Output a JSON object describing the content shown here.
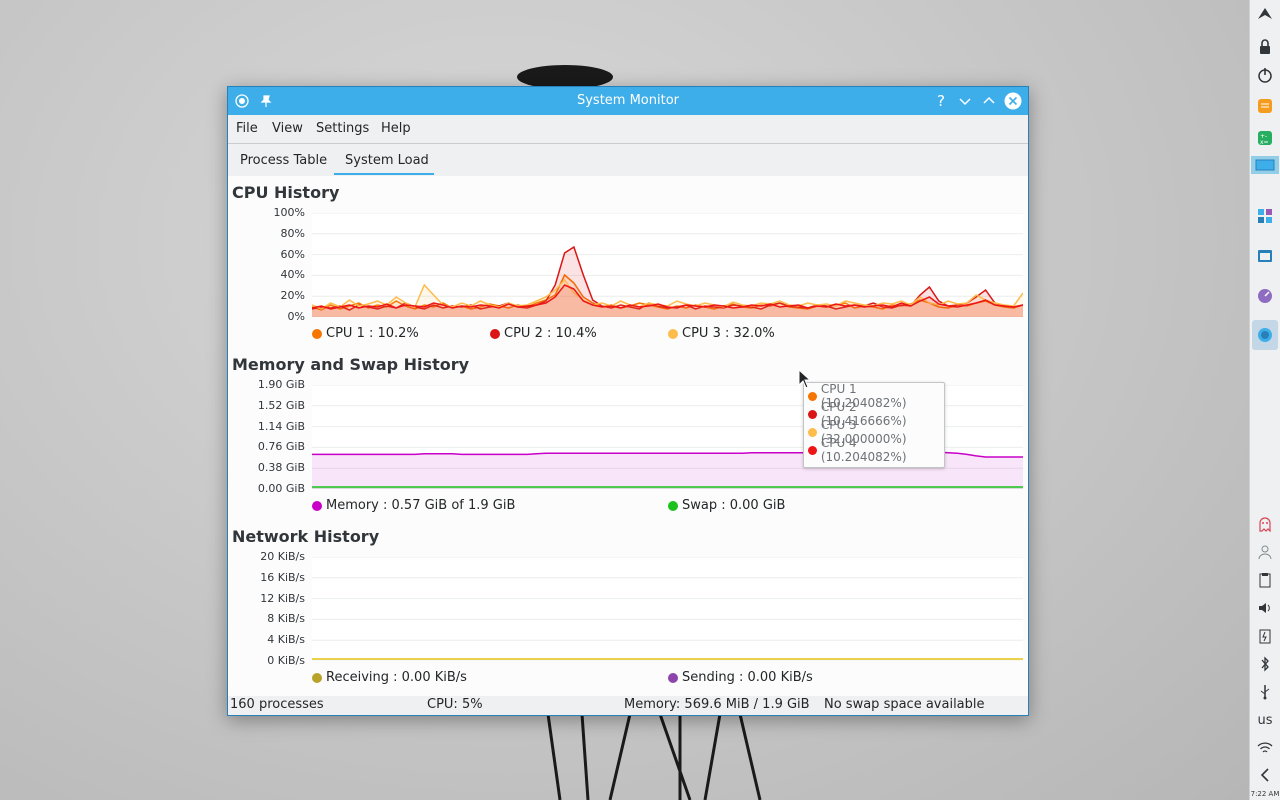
{
  "window": {
    "title": "System Monitor",
    "help_glyph": "?",
    "minimize_glyph": "⌄",
    "maximize_glyph": "⌃",
    "close_glyph": "✕",
    "pin_glyph": "📌"
  },
  "menu": [
    "File",
    "View",
    "Settings",
    "Help"
  ],
  "tabs": [
    {
      "label": "Process Table",
      "active": false
    },
    {
      "label": "System Load",
      "active": true
    }
  ],
  "cpu": {
    "title": "CPU History",
    "yticks": [
      "100%",
      "80%",
      "60%",
      "40%",
      "20%",
      "0%"
    ],
    "legend": [
      {
        "label": "CPU 1 : 10.2%",
        "color": "#f67400"
      },
      {
        "label": "CPU 2 : 10.4%",
        "color": "#da1515"
      },
      {
        "label": "CPU 3 : 32.0%",
        "color": "#fdbc4b"
      }
    ],
    "tooltip": [
      {
        "label": "CPU 1 (10.204082%)",
        "color": "#f67400"
      },
      {
        "label": "CPU 2 (10.416666%)",
        "color": "#da1515"
      },
      {
        "label": "CPU 3 (32.000000%)",
        "color": "#fdbc4b"
      },
      {
        "label": "CPU 4 (10.204082%)",
        "color": "#ed1515"
      }
    ]
  },
  "memory": {
    "title": "Memory and Swap History",
    "yticks": [
      "1.90 GiB",
      "1.52 GiB",
      "1.14 GiB",
      "0.76 GiB",
      "0.38 GiB",
      "0.00 GiB"
    ],
    "legend": [
      {
        "label": "Memory : 0.57 GiB of 1.9 GiB",
        "color": "#c800c8"
      },
      {
        "label": "Swap : 0.00 GiB",
        "color": "#1cc11c"
      }
    ]
  },
  "network": {
    "title": "Network History",
    "yticks": [
      "20 KiB/s",
      "16 KiB/s",
      "12 KiB/s",
      "8 KiB/s",
      "4 KiB/s",
      "0 KiB/s"
    ],
    "legend": [
      {
        "label": "Receiving : 0.00 KiB/s",
        "color": "#b8a229"
      },
      {
        "label": "Sending : 0.00 KiB/s",
        "color": "#8e44ad"
      }
    ]
  },
  "status": {
    "processes": "160 processes",
    "cpu": "CPU: 5%",
    "memory": "Memory: 569.6 MiB / 1.9 GiB",
    "swap": "No swap space available"
  },
  "tray": {
    "keyboard_layout": "us",
    "clock": "7:22 AM"
  },
  "chart_data": [
    {
      "type": "area",
      "title": "CPU History",
      "ylim": [
        0,
        100
      ],
      "yunit": "%",
      "series": [
        {
          "name": "CPU 1",
          "color": "#f67400",
          "values": [
            8,
            5,
            10,
            6,
            9,
            12,
            7,
            10,
            8,
            14,
            9,
            6,
            10,
            8,
            12,
            7,
            9,
            6,
            8,
            11,
            9,
            7,
            10,
            8,
            12,
            15,
            20,
            40,
            32,
            18,
            12,
            8,
            10,
            7,
            9,
            12,
            10,
            8,
            6,
            9,
            7,
            10,
            8,
            6,
            9,
            11,
            8,
            7,
            10,
            9,
            12,
            8,
            7,
            6,
            9,
            8,
            10,
            12,
            7,
            9,
            8,
            6,
            10,
            9,
            11,
            15,
            12,
            8,
            7,
            10,
            9,
            12,
            14,
            10,
            8,
            7,
            10
          ]
        },
        {
          "name": "CPU 2",
          "color": "#da1515",
          "values": [
            6,
            8,
            7,
            9,
            5,
            10,
            8,
            6,
            9,
            7,
            12,
            8,
            6,
            10,
            7,
            9,
            8,
            10,
            6,
            8,
            9,
            12,
            8,
            7,
            10,
            14,
            30,
            62,
            68,
            40,
            15,
            9,
            7,
            10,
            8,
            6,
            12,
            9,
            7,
            8,
            10,
            6,
            9,
            8,
            7,
            10,
            9,
            8,
            6,
            10,
            12,
            9,
            8,
            7,
            10,
            9,
            6,
            8,
            10,
            9,
            12,
            8,
            7,
            10,
            9,
            20,
            28,
            14,
            9,
            10,
            12,
            18,
            25,
            12,
            9,
            8,
            10
          ]
        },
        {
          "name": "CPU 3",
          "color": "#fdbc4b",
          "values": [
            10,
            6,
            12,
            8,
            15,
            9,
            11,
            14,
            10,
            18,
            12,
            8,
            30,
            20,
            10,
            8,
            12,
            9,
            14,
            10,
            8,
            12,
            9,
            10,
            14,
            18,
            25,
            35,
            22,
            15,
            10,
            12,
            9,
            14,
            10,
            8,
            12,
            10,
            9,
            14,
            11,
            9,
            12,
            10,
            8,
            13,
            10,
            9,
            12,
            11,
            14,
            10,
            9,
            12,
            10,
            11,
            9,
            14,
            12,
            10,
            9,
            12,
            11,
            14,
            10,
            18,
            12,
            10,
            14,
            11,
            12,
            20,
            15,
            12,
            10,
            9,
            22
          ]
        },
        {
          "name": "CPU 4",
          "color": "#ed1515",
          "values": [
            7,
            9,
            6,
            8,
            10,
            7,
            9,
            8,
            11,
            7,
            10,
            9,
            8,
            12,
            10,
            7,
            9,
            8,
            10,
            9,
            7,
            11,
            8,
            9,
            10,
            12,
            18,
            30,
            26,
            14,
            10,
            8,
            9,
            7,
            10,
            8,
            9,
            11,
            8,
            7,
            10,
            9,
            8,
            10,
            9,
            7,
            8,
            10,
            9,
            11,
            8,
            9,
            10,
            7,
            9,
            8,
            11,
            9,
            10,
            8,
            9,
            10,
            8,
            12,
            9,
            14,
            18,
            11,
            9,
            8,
            10,
            12,
            15,
            10,
            9,
            8,
            10
          ]
        }
      ]
    },
    {
      "type": "area",
      "title": "Memory and Swap History",
      "ylim": [
        0,
        1.9
      ],
      "yunit": "GiB",
      "series": [
        {
          "name": "Memory",
          "color": "#c800c8",
          "values": [
            0.62,
            0.62,
            0.62,
            0.62,
            0.62,
            0.62,
            0.62,
            0.62,
            0.62,
            0.62,
            0.62,
            0.62,
            0.63,
            0.63,
            0.63,
            0.63,
            0.62,
            0.62,
            0.62,
            0.62,
            0.62,
            0.62,
            0.62,
            0.62,
            0.63,
            0.64,
            0.64,
            0.64,
            0.64,
            0.64,
            0.64,
            0.64,
            0.64,
            0.64,
            0.64,
            0.64,
            0.64,
            0.64,
            0.64,
            0.64,
            0.64,
            0.64,
            0.64,
            0.64,
            0.64,
            0.64,
            0.64,
            0.65,
            0.65,
            0.65,
            0.65,
            0.65,
            0.65,
            0.65,
            0.65,
            0.65,
            0.65,
            0.65,
            0.65,
            0.66,
            0.66,
            0.66,
            0.66,
            0.66,
            0.66,
            0.66,
            0.66,
            0.66,
            0.65,
            0.64,
            0.62,
            0.59,
            0.57,
            0.57,
            0.57,
            0.57,
            0.57
          ]
        },
        {
          "name": "Swap",
          "color": "#1cc11c",
          "values": [
            0,
            0,
            0,
            0,
            0,
            0,
            0,
            0,
            0,
            0,
            0,
            0,
            0,
            0,
            0,
            0,
            0,
            0,
            0,
            0,
            0,
            0,
            0,
            0,
            0,
            0,
            0,
            0,
            0,
            0,
            0,
            0,
            0,
            0,
            0,
            0,
            0,
            0,
            0,
            0,
            0,
            0,
            0,
            0,
            0,
            0,
            0,
            0,
            0,
            0,
            0,
            0,
            0,
            0,
            0,
            0,
            0,
            0,
            0,
            0,
            0,
            0,
            0,
            0,
            0,
            0,
            0,
            0,
            0,
            0,
            0,
            0,
            0,
            0,
            0,
            0,
            0
          ]
        }
      ]
    },
    {
      "type": "line",
      "title": "Network History",
      "ylim": [
        0,
        20
      ],
      "yunit": "KiB/s",
      "series": [
        {
          "name": "Receiving",
          "color": "#b8a229",
          "values": [
            0,
            0,
            0,
            0,
            0,
            0,
            0,
            0,
            0,
            0
          ]
        },
        {
          "name": "Sending",
          "color": "#8e44ad",
          "values": [
            0,
            0,
            0,
            0,
            0,
            0,
            0,
            0,
            0,
            0
          ]
        }
      ]
    }
  ]
}
